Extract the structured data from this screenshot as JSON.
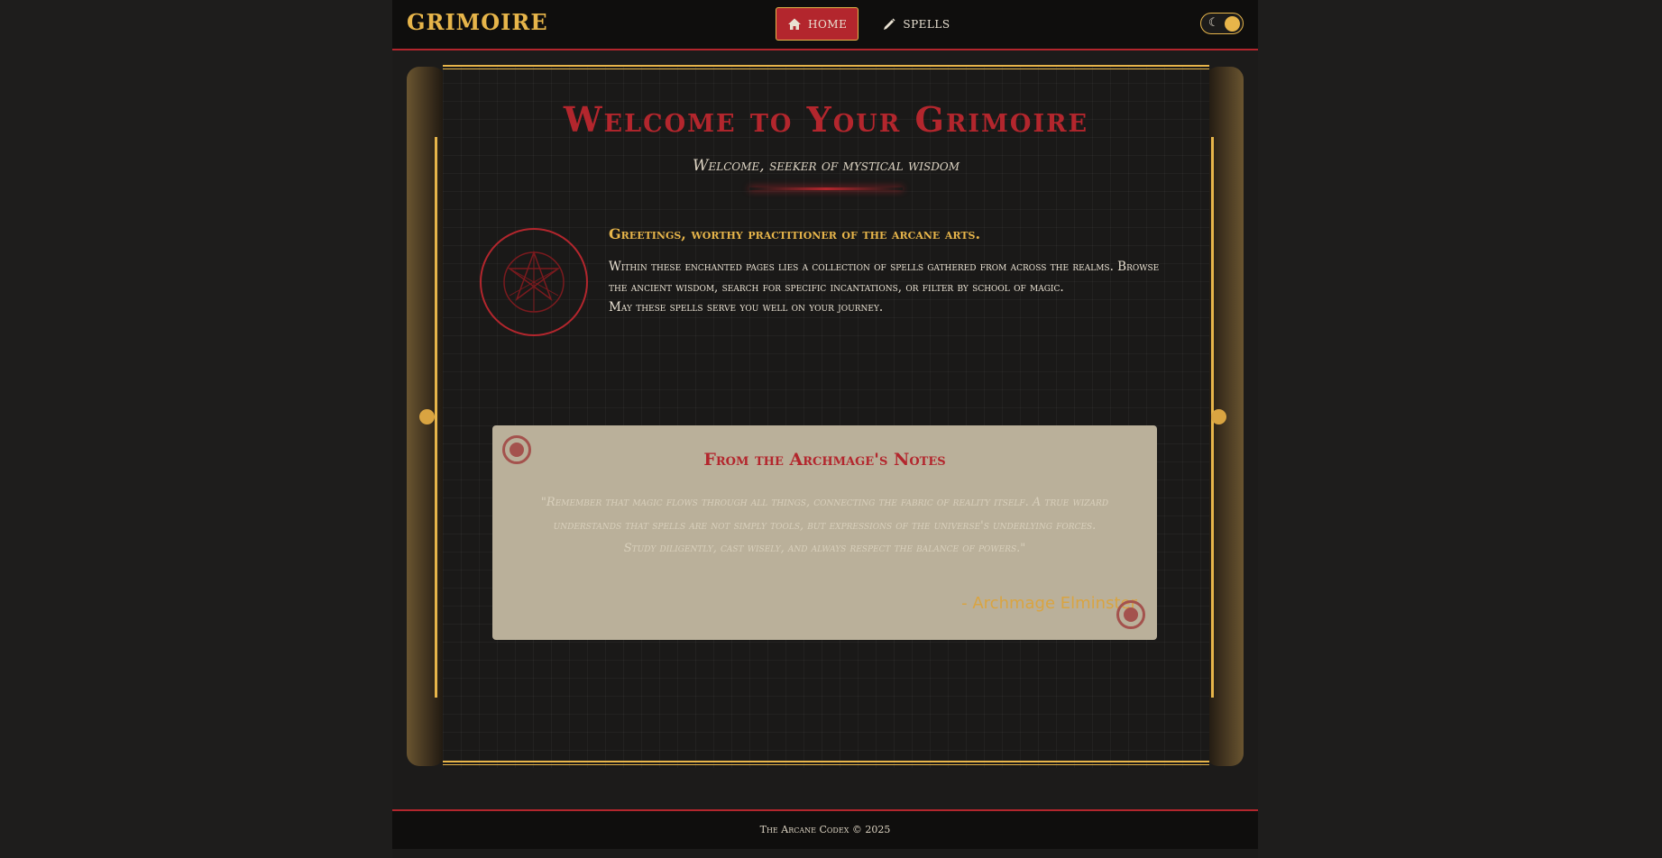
{
  "header": {
    "logo": "GRIMOIRE",
    "nav": [
      {
        "label": "Home",
        "icon": "home-icon",
        "active": true
      },
      {
        "label": "Spells",
        "icon": "quill-icon",
        "active": false
      }
    ],
    "theme_toggle": {
      "icon": "moon-icon"
    }
  },
  "main": {
    "title": "Welcome to Your Grimoire",
    "subtitle": "Welcome, seeker of mystical wisdom",
    "greeting_heading": "Greetings, worthy practitioner of the arcane arts.",
    "greeting_body_1": "Within these enchanted pages lies a collection of spells gathered from across the realms. Browse the ancient wisdom, search for specific incantations, or filter by school of magic.",
    "greeting_body_2": "May these spells serve you well on your journey."
  },
  "notes": {
    "title": "From the Archmage's Notes",
    "quote": "\"Remember that magic flows through all things, connecting the fabric of reality itself. A true wizard understands that spells are not simply tools, but expressions of the universe's underlying forces. Study diligently, cast wisely, and always respect the balance of powers.\"",
    "signature": "- Archmage Elminster"
  },
  "footer": {
    "text": "The Arcane Codex © 2025"
  },
  "colors": {
    "accent_red": "#b3262d",
    "accent_gold": "#e7b54a",
    "background": "#1c1b1a",
    "parchment": "#bab09a"
  }
}
